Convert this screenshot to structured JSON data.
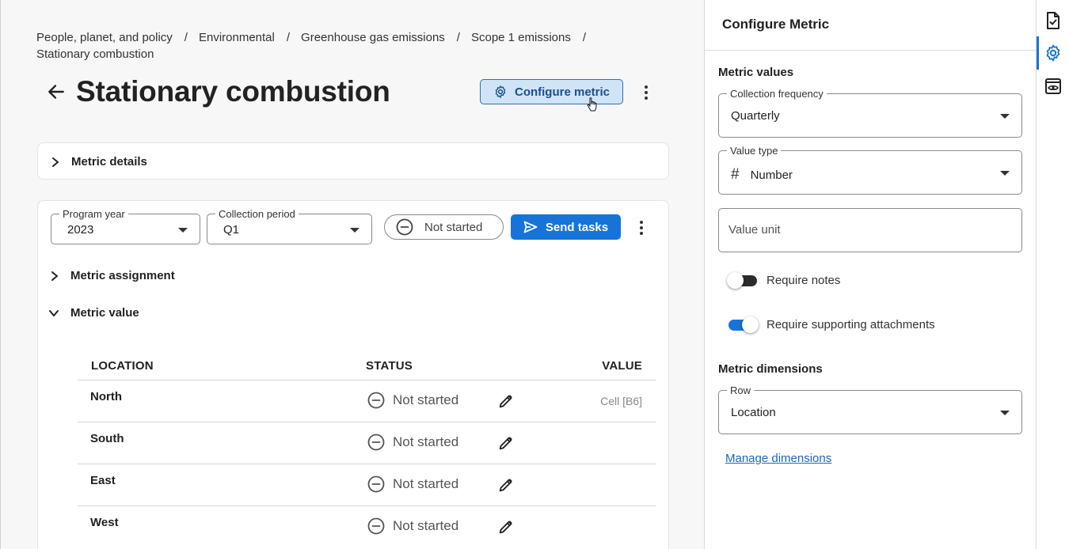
{
  "breadcrumb": [
    "People, planet, and policy",
    "Environmental",
    "Greenhouse gas emissions",
    "Scope 1 emissions",
    "Stationary combustion"
  ],
  "breadcrumb_separator": "/",
  "page": {
    "title": "Stationary combustion",
    "configure_label": "Configure metric"
  },
  "metric_details_label": "Metric details",
  "controls": {
    "program_year_label": "Program year",
    "program_year_value": "2023",
    "collection_period_label": "Collection period",
    "collection_period_value": "Q1",
    "status_label": "Not started",
    "send_tasks_label": "Send tasks"
  },
  "metric_assignment_label": "Metric assignment",
  "metric_value_label": "Metric value",
  "table": {
    "headers": {
      "location": "LOCATION",
      "status": "STATUS",
      "value": "VALUE"
    },
    "rows": [
      {
        "location": "North",
        "status": "Not started",
        "value": "Cell [B6]"
      },
      {
        "location": "South",
        "status": "Not started",
        "value": ""
      },
      {
        "location": "East",
        "status": "Not started",
        "value": ""
      },
      {
        "location": "West",
        "status": "Not started",
        "value": ""
      }
    ]
  },
  "panel": {
    "title": "Configure Metric",
    "metric_values_label": "Metric values",
    "collection_frequency_label": "Collection frequency",
    "collection_frequency_value": "Quarterly",
    "value_type_label": "Value type",
    "value_type_value": "Number",
    "value_type_icon": "#",
    "value_unit_placeholder": "Value unit",
    "require_notes_label": "Require notes",
    "require_notes_on": false,
    "require_attachments_label": "Require supporting attachments",
    "require_attachments_on": true,
    "metric_dimensions_label": "Metric dimensions",
    "row_label": "Row",
    "row_value": "Location",
    "manage_dimensions_label": "Manage dimensions"
  },
  "colors": {
    "accent": "#1673d9",
    "config_btn_bg": "#cfe4f7",
    "toggle_off": "#2b2b2b",
    "toggle_on": "#1673d9"
  },
  "icons": {
    "back": "arrow-left-icon",
    "configure": "gear-icon",
    "status": "minus-circle-icon",
    "send": "send-icon",
    "edit": "pencil-icon",
    "rail": [
      "document-check-icon",
      "gear-icon",
      "eye-preview-icon"
    ]
  }
}
